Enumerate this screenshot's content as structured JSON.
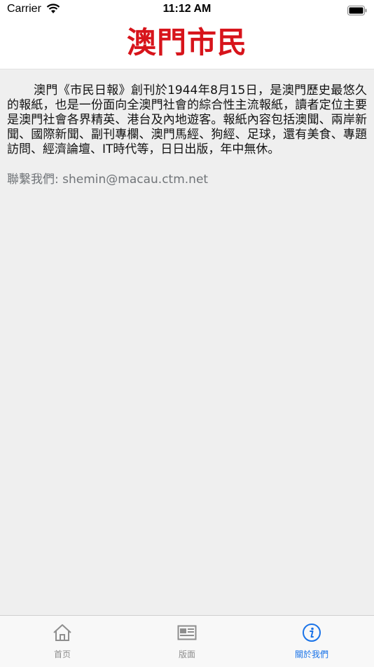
{
  "status_bar": {
    "carrier": "Carrier",
    "time": "11:12 AM"
  },
  "header": {
    "logo_text": "澳門市民"
  },
  "about": {
    "body": "澳門《市民日報》創刊於1944年8月15日，是澳門歷史最悠久的報紙，也是一份面向全澳門社會的綜合性主流報紙，讀者定位主要是澳門社會各界精英、港台及內地遊客。報紙內容包括澳聞、兩岸新聞、國際新聞、副刊專欄、澳門馬經、狗經、足球，還有美食、專題訪問、經濟論壇、IT時代等，日日出版，年中無休。",
    "contact": "聯繫我們: shemin@macau.ctm.net"
  },
  "tabs": [
    {
      "label": "首页",
      "icon": "home-icon",
      "active": false
    },
    {
      "label": "版面",
      "icon": "newspaper-icon",
      "active": false
    },
    {
      "label": "關於我們",
      "icon": "info-icon",
      "active": true
    }
  ],
  "colors": {
    "accent": "#1a73e8",
    "logo_red": "#d7141b",
    "background": "#efefef"
  }
}
